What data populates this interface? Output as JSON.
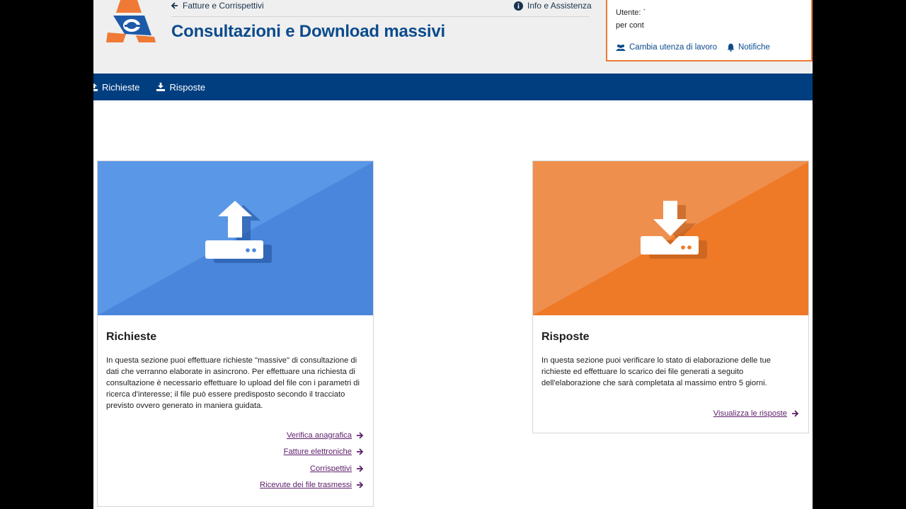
{
  "header": {
    "back_link": "Fatture e Corrispettivi",
    "info_link": "Info e Assistenza",
    "title": "Consultazioni e Download massivi",
    "user_label": "Utente: `",
    "user_org": "per cont",
    "change_work": "Cambia utenza di lavoro",
    "notifications": "Notifiche"
  },
  "nav": {
    "items": [
      {
        "label": "Richieste",
        "icon": "upload-icon"
      },
      {
        "label": "Risposte",
        "icon": "download-icon"
      }
    ]
  },
  "cards": {
    "richieste": {
      "title": "Richieste",
      "description": "In questa sezione puoi effettuare richieste \"massive\" di consultazione di dati che verranno elaborate in asincrono. Per effettuare una richiesta di consultazione è necessario effettuare lo upload del file con i parametri di ricerca d'interesse; il file può essere predisposto secondo il tracciato previsto ovvero generato in maniera guidata.",
      "links": [
        "Verifica anagrafica",
        "Fatture elettroniche",
        "Corrispettivi",
        "Ricevute dei file trasmessi"
      ],
      "color_light": "#5a97e6",
      "color_dark": "#4a86dc"
    },
    "risposte": {
      "title": "Risposte",
      "description": "In questa sezione puoi verificare lo stato di elaborazione delle tue richieste ed effettuare lo scarico dei file generati a seguito dell'elaborazione che sarà completata al massimo entro 5 giorni.",
      "links": [
        "Visualizza le risposte"
      ],
      "color_light": "#ef8f4e",
      "color_dark": "#ee7a28"
    }
  },
  "colors": {
    "brand_blue": "#0b4b8c",
    "nav_blue": "#003e80",
    "accent_orange": "#ee7a35",
    "link_purple": "#5e1e6b"
  }
}
